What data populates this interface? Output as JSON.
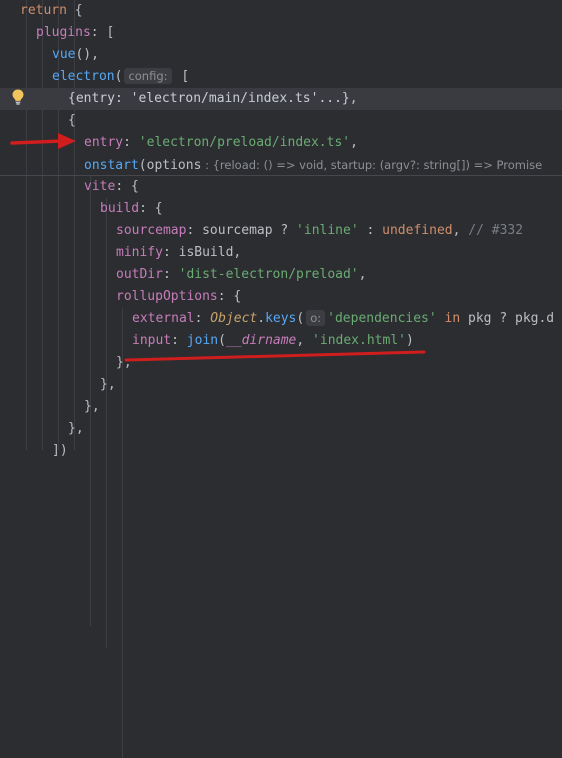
{
  "code": {
    "l1": {
      "kw": "return",
      "rest": " {"
    },
    "l2": {
      "prop": "plugins",
      "rest": ": ["
    },
    "l3": {
      "fn": "vue",
      "rest": "(),"
    },
    "l4": {
      "fn": "electron",
      "open": "(",
      "hint": "config:",
      "rest": " ["
    },
    "l5": {
      "text": "{entry: 'electron/main/index.ts'...}",
      "rest": ","
    },
    "l6": {
      "text": "{"
    },
    "l7": {
      "prop": "entry",
      "colon": ": ",
      "str": "'electron/preload/index.ts'",
      "rest": ","
    },
    "l8": {
      "fn": "onstart",
      "open": "(",
      "param": "options",
      "hint": " : {reload: () => void, startup: (argv?: string[]) => Promise"
    },
    "l9": {
      "prop": "vite",
      "rest": ": {"
    },
    "l10": {
      "prop": "build",
      "rest": ": {"
    },
    "l11": {
      "prop": "sourcemap",
      "colon": ": ",
      "id": "sourcemap",
      "q": " ? ",
      "str": "'inline'",
      "c2": " : ",
      "kw": "undefined",
      "rest": ", ",
      "cmt": "// #332"
    },
    "l12": {
      "prop": "minify",
      "colon": ": ",
      "id": "isBuild",
      "rest": ","
    },
    "l13": {
      "prop": "outDir",
      "colon": ": ",
      "str": "'dist-electron/preload'",
      "rest": ","
    },
    "l14": {
      "prop": "rollupOptions",
      "rest": ": {"
    },
    "l15": {
      "prop": "external",
      "colon": ": ",
      "cls": "Object",
      "dot": ".",
      "fn": "keys",
      "open": "(",
      "hint": "o:",
      "str": "'dependencies'",
      "kw": " in ",
      "id": "pkg",
      "rest": " ? pkg.d"
    },
    "l16": {
      "prop": "input",
      "colon": ": ",
      "fn": "join",
      "open": "(",
      "dn": "__dirname",
      "comma": ", ",
      "str": "'index.html'",
      "rest": ")"
    },
    "l17": {
      "text": "},"
    },
    "l18": {
      "text": "},"
    },
    "l19": {
      "text": "},"
    },
    "l20": {
      "text": "},"
    },
    "l21": {
      "text": "])"
    }
  },
  "colors": {
    "background": "#2b2d30",
    "keyword": "#cf8e6d",
    "function": "#56a8f5",
    "property": "#c77dbb",
    "string": "#6aab73",
    "comment": "#7a7e85",
    "annotation_red": "#d01d1d"
  },
  "icons": {
    "bulb": "lightbulb-icon",
    "arrow": "red-arrow-annotation",
    "underline": "red-underline-annotation"
  }
}
